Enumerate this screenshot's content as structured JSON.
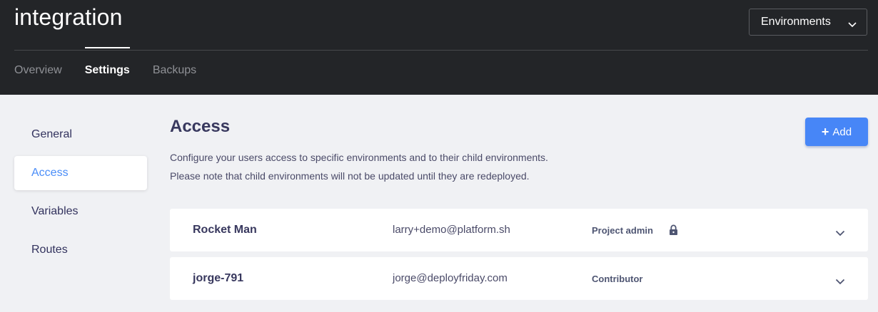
{
  "header": {
    "project_title": "integration",
    "environments_label": "Environments",
    "tabs": [
      {
        "label": "Overview",
        "active": false
      },
      {
        "label": "Settings",
        "active": true
      },
      {
        "label": "Backups",
        "active": false
      }
    ]
  },
  "sidebar": {
    "items": [
      {
        "label": "General",
        "active": false
      },
      {
        "label": "Access",
        "active": true
      },
      {
        "label": "Variables",
        "active": false
      },
      {
        "label": "Routes",
        "active": false
      }
    ]
  },
  "main": {
    "title": "Access",
    "add_label": "Add",
    "description_lines": [
      "Configure your users access to specific environments and to their child environments.",
      "Please note that child environments will not be updated until they are redeployed."
    ],
    "users": [
      {
        "name": "Rocket Man",
        "email": "larry+demo@platform.sh",
        "role": "Project admin",
        "locked": true
      },
      {
        "name": "jorge-791",
        "email": "jorge@deployfriday.com",
        "role": "Contributor",
        "locked": false
      }
    ]
  },
  "colors": {
    "header_bg": "#232528",
    "accent": "#4786f7",
    "page_bg": "#f0f1f4"
  },
  "icons": {
    "dropdown": "chevron-down-icon",
    "add": "plus-icon",
    "lock": "lock-icon",
    "row_expand": "chevron-down-icon"
  }
}
